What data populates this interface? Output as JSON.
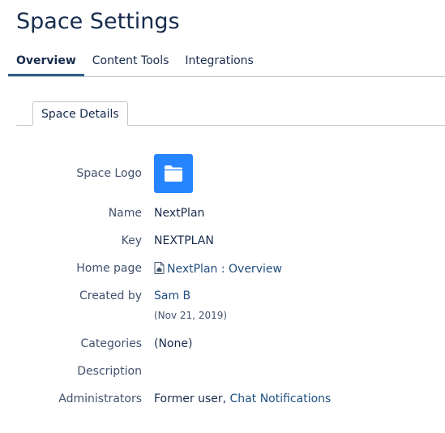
{
  "page": {
    "title": "Space Settings"
  },
  "main_tabs": [
    {
      "label": "Overview",
      "active": true
    },
    {
      "label": "Content Tools",
      "active": false
    },
    {
      "label": "Integrations",
      "active": false
    }
  ],
  "sub_tabs": [
    {
      "label": "Space Details",
      "active": true
    }
  ],
  "details": {
    "logo": {
      "label": "Space Logo",
      "icon": "folder-icon",
      "color": "#2684FF"
    },
    "name": {
      "label": "Name",
      "value": "NextPlan"
    },
    "key": {
      "label": "Key",
      "value": "NEXTPLAN"
    },
    "home_page": {
      "label": "Home page",
      "value": "NextPlan : Overview",
      "icon": "home-page-icon"
    },
    "created_by": {
      "label": "Created by",
      "value": "Sam B",
      "date": "(Nov 21, 2019)"
    },
    "categories": {
      "label": "Categories",
      "value": "(None)"
    },
    "description": {
      "label": "Description",
      "value": ""
    },
    "administrators": {
      "label": "Administrators",
      "plain_value": "Former user,",
      "link_value": "Chat Notifications"
    }
  },
  "colors": {
    "link": "#205081",
    "active_tab_underline": "#2F5F87",
    "logo_bg": "#2684FF"
  }
}
